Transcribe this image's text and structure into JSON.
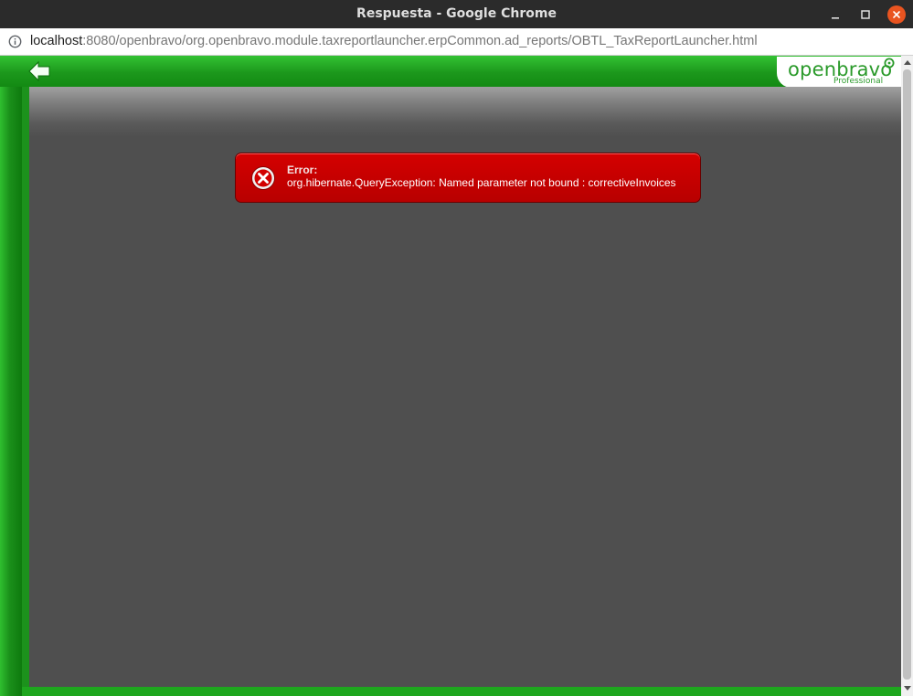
{
  "window": {
    "title": "Respuesta - Google Chrome"
  },
  "addressbar": {
    "host": "localhost",
    "path": ":8080/openbravo/org.openbravo.module.taxreportlauncher.erpCommon.ad_reports/OBTL_TaxReportLauncher.html"
  },
  "app": {
    "logo_text": "openbravo",
    "logo_subtitle": "Professional"
  },
  "error": {
    "title": "Error:",
    "message": "org.hibernate.QueryException: Named parameter not bound : correctiveInvoices"
  },
  "colors": {
    "brand_green": "#1e9a1e",
    "error_red": "#c80000",
    "content_gray": "#4f4f4f"
  },
  "icons": {
    "info": "info-icon",
    "back": "back-arrow-icon",
    "error": "error-x-icon"
  }
}
